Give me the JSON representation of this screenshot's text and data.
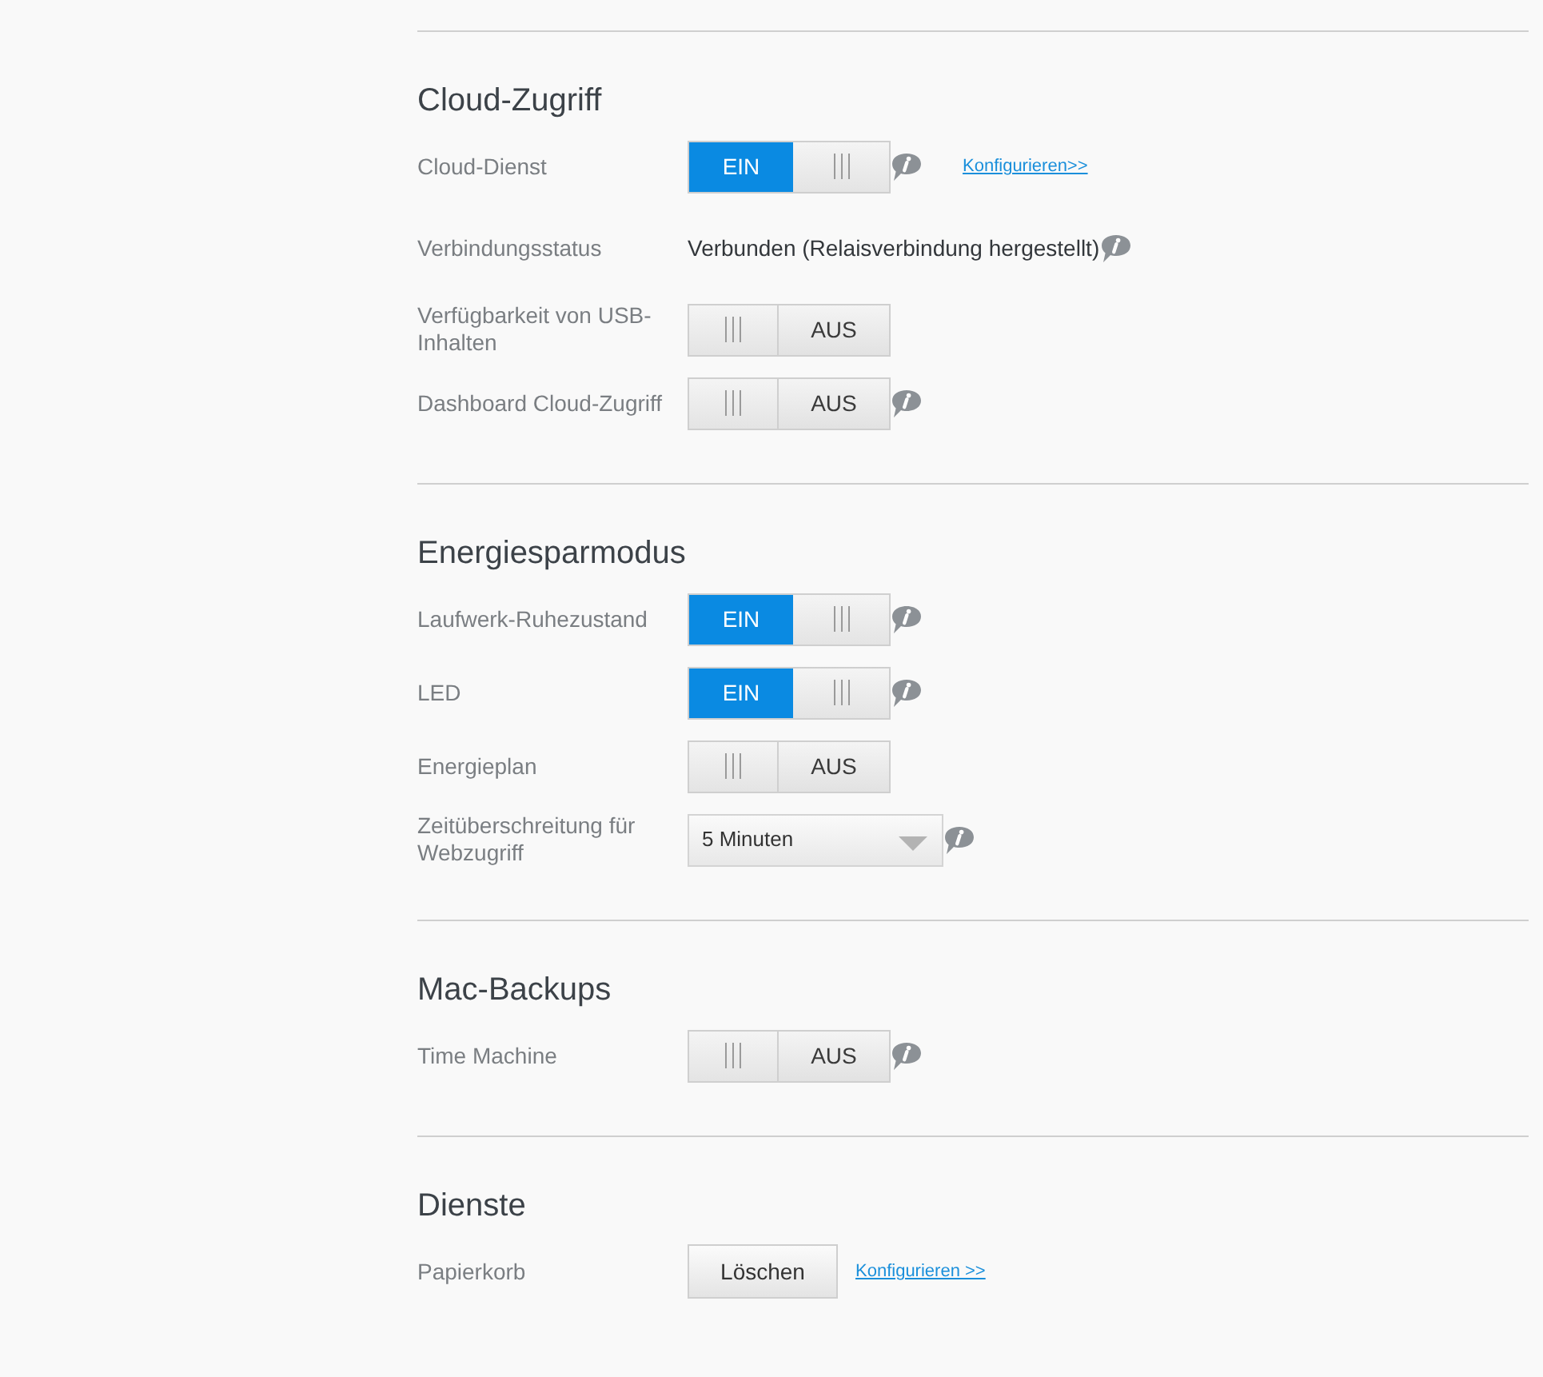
{
  "sections": [
    {
      "title": "Cloud-Zugriff",
      "rows": [
        {
          "kind": "toggle",
          "label": "Cloud-Dienst",
          "on": true,
          "state_text": "EIN",
          "info": true,
          "link": "Konfigurieren>>"
        },
        {
          "kind": "text",
          "label": "Verbindungsstatus",
          "value": "Verbunden (Relaisverbindung hergestellt)",
          "info": true
        },
        {
          "kind": "toggle",
          "label": "Verfügbarkeit von USB-Inhalten",
          "on": false,
          "state_text": "AUS",
          "info": false
        },
        {
          "kind": "toggle",
          "label": "Dashboard Cloud-Zugriff",
          "on": false,
          "state_text": "AUS",
          "info": true
        }
      ]
    },
    {
      "title": "Energiesparmodus",
      "rows": [
        {
          "kind": "toggle",
          "label": "Laufwerk-Ruhezustand",
          "on": true,
          "state_text": "EIN",
          "info": true
        },
        {
          "kind": "toggle",
          "label": "LED",
          "on": true,
          "state_text": "EIN",
          "info": true
        },
        {
          "kind": "toggle",
          "label": "Energieplan",
          "on": false,
          "state_text": "AUS",
          "info": false
        },
        {
          "kind": "select",
          "label": "Zeitüberschreitung für Webzugriff",
          "value": "5 Minuten",
          "info": true
        }
      ]
    },
    {
      "title": "Mac-Backups",
      "rows": [
        {
          "kind": "toggle",
          "label": "Time Machine",
          "on": false,
          "state_text": "AUS",
          "info": true
        }
      ]
    },
    {
      "title": "Dienste",
      "rows": [
        {
          "kind": "button",
          "label": "Papierkorb",
          "button": "Löschen",
          "info": false,
          "link": "Konfigurieren >>"
        }
      ]
    }
  ]
}
